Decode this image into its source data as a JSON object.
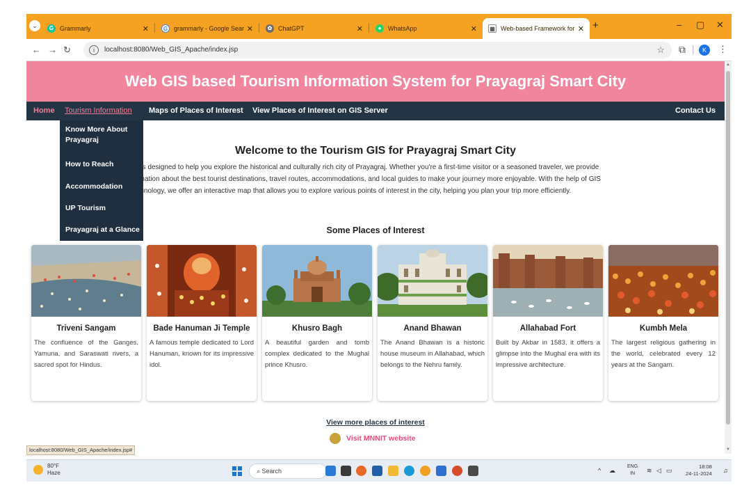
{
  "browser": {
    "tabs": [
      {
        "title": "Grammarly",
        "favicon_color": "#15c39a"
      },
      {
        "title": "grammarly - Google Search",
        "favicon_color": "#4285f4"
      },
      {
        "title": "ChatGPT",
        "favicon_color": "#6b6b6b"
      },
      {
        "title": "WhatsApp",
        "favicon_color": "#25d366"
      },
      {
        "title": "Web-based Framework for Tou",
        "favicon_color": "#8a8a8a"
      }
    ],
    "new_tab": "+",
    "window_controls": {
      "minimize": "–",
      "maximize": "▢",
      "close": "✕"
    },
    "url": "localhost:8080/Web_GIS_Apache/index.jsp",
    "profile_initial": "K"
  },
  "site": {
    "banner_title": "Web GIS based Tourism Information System for Prayagraj Smart City",
    "nav": {
      "home": "Home",
      "tourism": "Tourism Information",
      "maps": "Maps of Places of Interest",
      "gis": "View Places of Interest on GIS Server",
      "contact": "Contact Us"
    },
    "dropdown": [
      "Know More About Prayagraj",
      "How to Reach",
      "Accommodation",
      "UP Tourism",
      "Prayagraj at a Glance"
    ],
    "welcome_title": "Welcome to the Tourism GIS for Prayagraj Smart City",
    "intro_lines": [
      "rm is designed to help you explore the historical and culturally rich city of Prayagraj. Whether you're a first-time visitor or a seasoned traveler, we provide",
      "formation about the best tourist destinations, travel routes, accommodations, and local guides to make your journey more enjoyable. With the help of GIS",
      "technology, we offer an interactive map that allows you to explore various points of interest in the city, helping you plan your trip more efficiently."
    ],
    "poi_title": "Some Places of Interest",
    "places": [
      {
        "name": "Triveni Sangam",
        "desc": "The confluence of the Ganges, Yamuna, and Saraswati rivers, a sacred spot for Hindus."
      },
      {
        "name": "Bade Hanuman Ji Temple",
        "desc": "A famous temple dedicated to Lord Hanuman, known for its impressive idol."
      },
      {
        "name": "Khusro Bagh",
        "desc": "A beautiful garden and tomb complex dedicated to the Mughal prince Khusro."
      },
      {
        "name": "Anand Bhawan",
        "desc": "The Anand Bhawan is a historic house museum in Allahabad, which belongs to the Nehru family."
      },
      {
        "name": "Allahabad Fort",
        "desc": "Built by Akbar in 1583, it offers a glimpse into the Mughal era with its impressive architecture."
      },
      {
        "name": "Kumbh Mela",
        "desc": "The largest religious gathering in the world, celebrated every 12 years at the Sangam."
      }
    ],
    "view_more": "View more places of interest",
    "mnnit_link": "Visit MNNIT website",
    "status_url": "localhost:8080/Web_GIS_Apache/index.jsp#"
  },
  "taskbar": {
    "temperature": "80°F",
    "weather": "Haze",
    "search_placeholder": "Search",
    "lang_top": "ENG",
    "lang_bottom": "IN",
    "time": "18:08",
    "date": "24-11-2024"
  },
  "colors": {
    "banner": "#f2859e",
    "nav": "#233545",
    "accent_pink": "#f77b96",
    "tabstrip": "#f5a223"
  }
}
